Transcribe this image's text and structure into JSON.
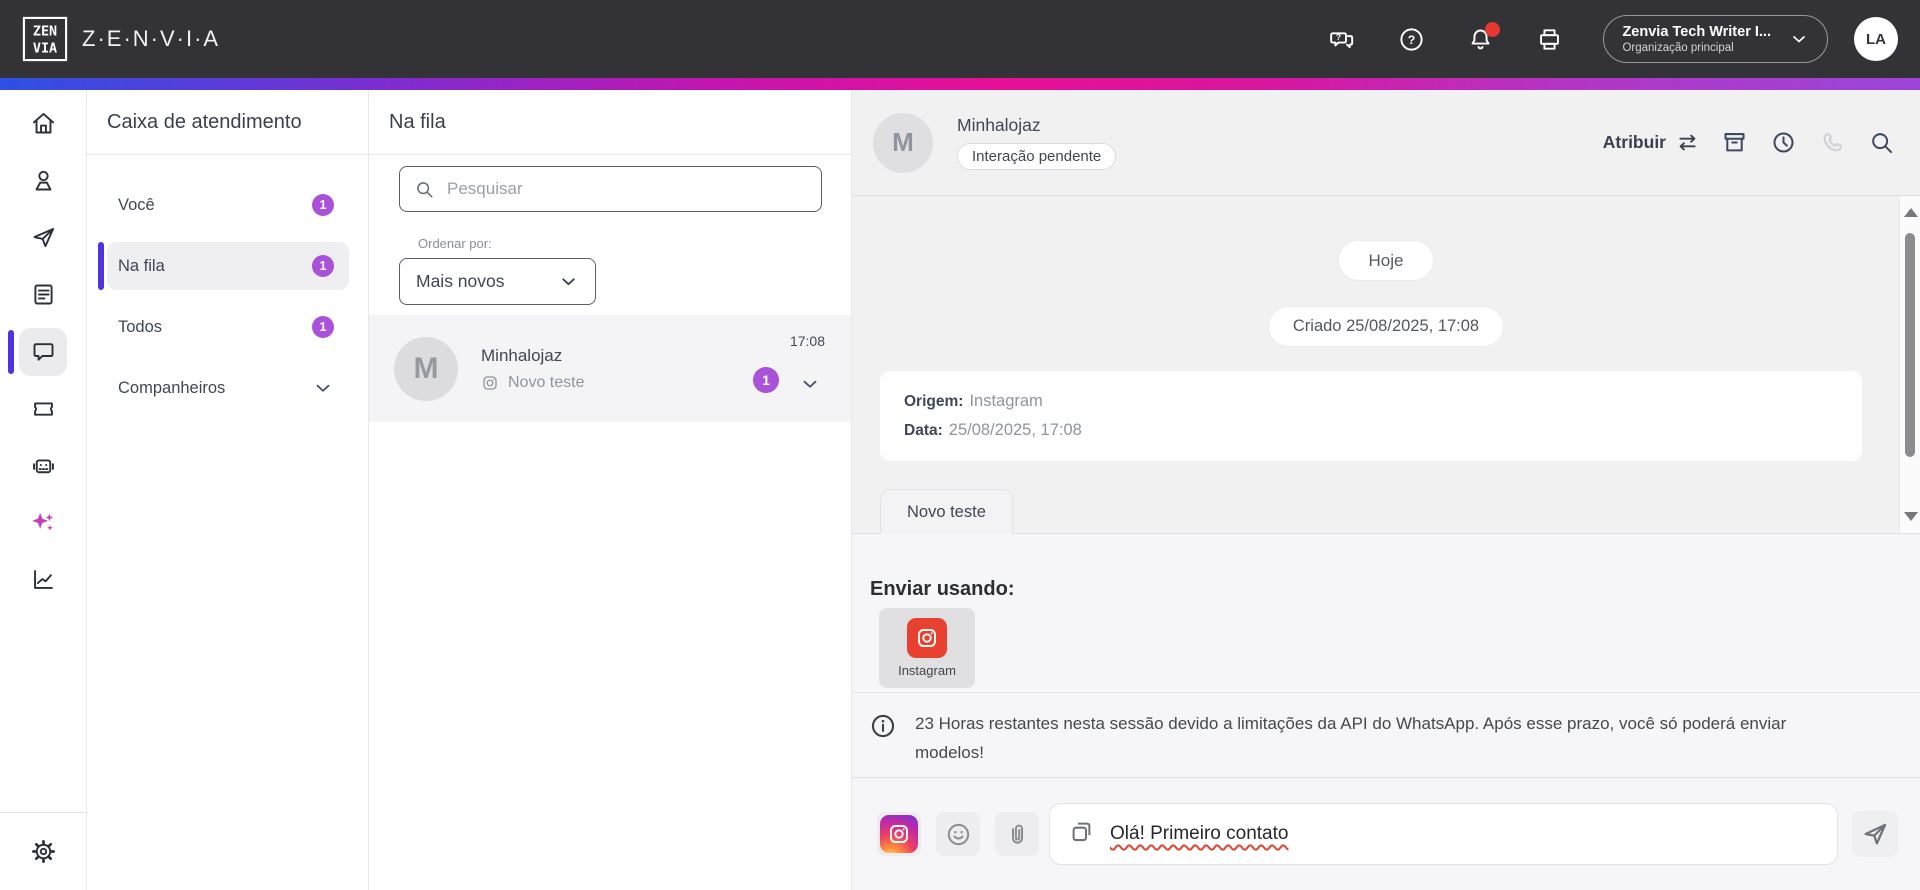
{
  "topbar": {
    "brand": "Z·E·N·V·I·A",
    "icons": [
      "support-chat",
      "help",
      "notifications",
      "printer"
    ],
    "notifications_unread": true,
    "org": {
      "name": "Zenvia Tech Writer I...",
      "subtitle": "Organização principal"
    },
    "avatar_initials": "LA"
  },
  "nav_rail": {
    "icons": [
      "home",
      "contacts",
      "send",
      "posts",
      "chats",
      "tickets",
      "bot",
      "ai-assistant",
      "reports",
      "settings"
    ],
    "active": "chats"
  },
  "inbox": {
    "title": "Caixa de atendimento",
    "items": [
      {
        "label": "Você",
        "badge": "1"
      },
      {
        "label": "Na fila",
        "badge": "1"
      },
      {
        "label": "Todos",
        "badge": "1"
      },
      {
        "label": "Companheiros",
        "badge": ""
      }
    ]
  },
  "queue": {
    "title": "Na fila",
    "search_placeholder": "Pesquisar",
    "sort_label": "Ordenar por:",
    "sort_value": "Mais novos",
    "conversation": {
      "initial": "M",
      "name": "Minhalojaz",
      "preview": "Novo teste",
      "channel_icon": "instagram",
      "time": "17:08",
      "unread": "1"
    }
  },
  "chat": {
    "contact": {
      "initial": "M",
      "name": "Minhalojaz",
      "status": "Interação pendente"
    },
    "assign_label": "Atribuir",
    "action_icons": [
      "transfer",
      "archive",
      "history",
      "phone",
      "search"
    ],
    "day_divider": "Hoje",
    "created_pill": "Criado 25/08/2025, 17:08",
    "origin_card": {
      "origin_label": "Origem:",
      "origin_value": "Instagram",
      "date_label": "Data:",
      "date_value": "25/08/2025, 17:08"
    },
    "tab_label": "Novo teste",
    "send_using": {
      "heading": "Enviar usando:",
      "channel_label": "Instagram",
      "channel_icon": "instagram"
    },
    "session_notice": "23 Horas restantes nesta sessão devido a limitações da API do WhatsApp. Após esse prazo, você só poderá enviar modelos!",
    "composer": {
      "icons": [
        "instagram",
        "emoji",
        "attachment",
        "templates",
        "send"
      ],
      "message": "Olá! Primeiro contato"
    }
  },
  "colors": {
    "topbar_bg": "#333337",
    "accent_purple": "#a952d9",
    "active_indigo": "#5133e0",
    "notification_red": "#e5382e",
    "instagram_red": "#e8412f",
    "chat_bg": "#f1f1f2",
    "gradient": [
      "#2d50e4",
      "#c615ae",
      "#e60f97",
      "#9b45d8"
    ]
  }
}
